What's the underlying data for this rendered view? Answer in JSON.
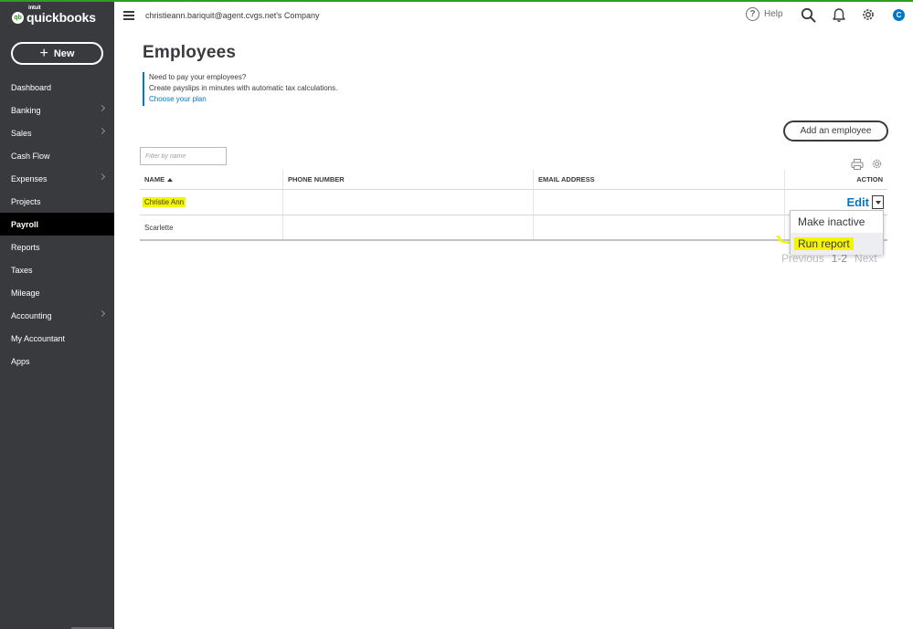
{
  "sidebar": {
    "logo_brand": "intuit",
    "logo_name": "quickbooks",
    "new_label": "New",
    "items": [
      {
        "label": "Dashboard",
        "chevron": false
      },
      {
        "label": "Banking",
        "chevron": true
      },
      {
        "label": "Sales",
        "chevron": true
      },
      {
        "label": "Cash Flow",
        "chevron": false
      },
      {
        "label": "Expenses",
        "chevron": true
      },
      {
        "label": "Projects",
        "chevron": false
      },
      {
        "label": "Payroll",
        "chevron": false,
        "active": true
      },
      {
        "label": "Reports",
        "chevron": false
      },
      {
        "label": "Taxes",
        "chevron": false
      },
      {
        "label": "Mileage",
        "chevron": false
      },
      {
        "label": "Accounting",
        "chevron": true
      },
      {
        "label": "My Accountant",
        "chevron": false
      },
      {
        "label": "Apps",
        "chevron": false
      }
    ]
  },
  "header": {
    "company": "christieann.bariquit@agent.cvgs.net's Company",
    "help_label": "Help",
    "avatar_initial": "C",
    "icons": [
      "menu-icon",
      "help-icon",
      "search-icon",
      "bell-icon",
      "gear-icon"
    ]
  },
  "main": {
    "title": "Employees",
    "promo": {
      "line1": "Need to pay your employees?",
      "line2": "Create payslips in minutes with automatic tax calculations.",
      "link": "Choose your plan"
    },
    "add_button": "Add an employee",
    "filter_placeholder": "Filter by name",
    "table": {
      "columns": [
        "NAME",
        "PHONE NUMBER",
        "EMAIL ADDRESS",
        "ACTION"
      ],
      "rows": [
        {
          "name": "Christie Ann",
          "phone": "",
          "email": "",
          "action": "Edit",
          "highlighted": true
        },
        {
          "name": "Scarlette",
          "phone": "",
          "email": "",
          "action": ""
        }
      ]
    },
    "pager": {
      "previous": "Previous",
      "range": "1-2",
      "next": "Next"
    },
    "dropdown": {
      "items": [
        "Make inactive",
        "Run report"
      ]
    }
  },
  "colors": {
    "brand_green": "#2ca01c",
    "sidebar_bg": "#393a3d",
    "link_blue": "#0077c5",
    "highlight": "#f5f500"
  }
}
